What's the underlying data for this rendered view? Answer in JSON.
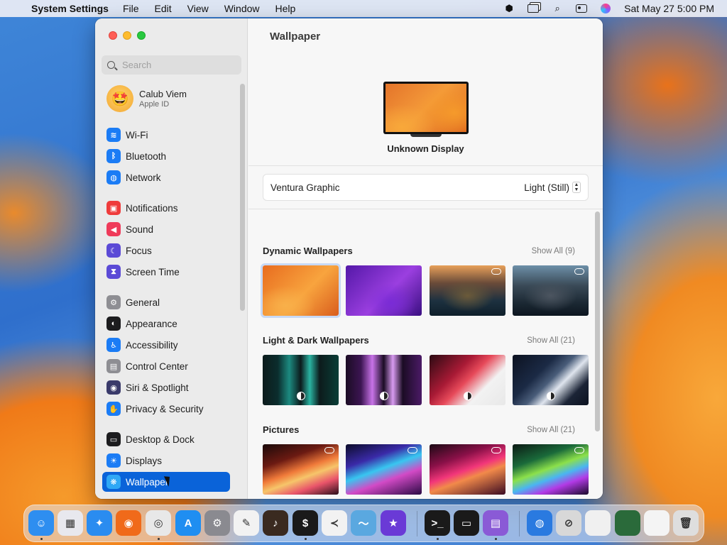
{
  "menubar": {
    "app_name": "System Settings",
    "menus": [
      "File",
      "Edit",
      "View",
      "Window",
      "Help"
    ],
    "datetime": "Sat May 27  5:00 PM"
  },
  "sidebar": {
    "search_placeholder": "Search",
    "user": {
      "name": "Calub Viem",
      "subtitle": "Apple ID"
    },
    "items": [
      {
        "label": "Wi-Fi",
        "icon": "wifi-icon",
        "color": "#1b7cf5"
      },
      {
        "label": "Bluetooth",
        "icon": "bluetooth-icon",
        "color": "#1b7cf5"
      },
      {
        "label": "Network",
        "icon": "globe-icon",
        "color": "#1b7cf5"
      },
      {
        "label": "Notifications",
        "icon": "bell-icon",
        "color": "#ef3b3b"
      },
      {
        "label": "Sound",
        "icon": "speaker-icon",
        "color": "#ef3b5a"
      },
      {
        "label": "Focus",
        "icon": "moon-icon",
        "color": "#5b4ad6"
      },
      {
        "label": "Screen Time",
        "icon": "hourglass-icon",
        "color": "#5b4ad6"
      },
      {
        "label": "General",
        "icon": "gear-icon",
        "color": "#8e8e93"
      },
      {
        "label": "Appearance",
        "icon": "appearance-icon",
        "color": "#1c1c1e"
      },
      {
        "label": "Accessibility",
        "icon": "accessibility-icon",
        "color": "#1b7cf5"
      },
      {
        "label": "Control Center",
        "icon": "control-center-icon",
        "color": "#8e8e93"
      },
      {
        "label": "Siri & Spotlight",
        "icon": "siri-icon",
        "color": "#3a3a6a"
      },
      {
        "label": "Privacy & Security",
        "icon": "hand-icon",
        "color": "#1b7cf5"
      },
      {
        "label": "Desktop & Dock",
        "icon": "desktop-icon",
        "color": "#1c1c1e"
      },
      {
        "label": "Displays",
        "icon": "sun-icon",
        "color": "#1b7cf5"
      },
      {
        "label": "Wallpaper",
        "icon": "wallpaper-icon",
        "color": "#2fa8f5",
        "selected": true
      }
    ]
  },
  "main": {
    "title": "Wallpaper",
    "display_name": "Unknown Display",
    "current_wallpaper": "Ventura Graphic",
    "mode": "Light (Still)",
    "sections": [
      {
        "title": "Dynamic Wallpapers",
        "show_all": "Show All (9)"
      },
      {
        "title": "Light & Dark Wallpapers",
        "show_all": "Show All (21)"
      },
      {
        "title": "Pictures",
        "show_all": "Show All (21)"
      }
    ]
  },
  "dock": {
    "apps": [
      {
        "name": "finder-icon",
        "color": "#2e8ef0",
        "glyph": "☺"
      },
      {
        "name": "launchpad-icon",
        "color": "#e8e8ee",
        "glyph": "▦"
      },
      {
        "name": "safari-icon",
        "color": "#2a8cf0",
        "glyph": "✦"
      },
      {
        "name": "firefox-icon",
        "color": "#f06a1a",
        "glyph": "◉"
      },
      {
        "name": "chrome-icon",
        "color": "#e8e8e8",
        "glyph": "◎"
      },
      {
        "name": "app-store-icon",
        "color": "#1f8ef1",
        "glyph": "A"
      },
      {
        "name": "system-settings-icon",
        "color": "#8a8a90",
        "glyph": "⚙"
      },
      {
        "name": "textedit-icon",
        "color": "#f2f2f2",
        "glyph": "✎"
      },
      {
        "name": "garageband-icon",
        "color": "#3a2a20",
        "glyph": "♪"
      },
      {
        "name": "terminal-green-icon",
        "color": "#1a1a1a",
        "glyph": "$"
      },
      {
        "name": "vscode-icon",
        "color": "#f2f2f2",
        "glyph": "≺"
      },
      {
        "name": "dolphin-icon",
        "color": "#5aa8e0",
        "glyph": "〜"
      },
      {
        "name": "imovie-icon",
        "color": "#6a3ad6",
        "glyph": "★"
      },
      {
        "name": "terminal-icon",
        "color": "#1a1a1a",
        "glyph": ">_"
      },
      {
        "name": "activity-monitor-icon",
        "color": "#1a1a1a",
        "glyph": "▭"
      },
      {
        "name": "storage-icon",
        "color": "#8a5ad6",
        "glyph": "▤"
      },
      {
        "name": "globe-app-icon",
        "color": "#2a7ae0",
        "glyph": "◍"
      },
      {
        "name": "disabled-app-icon",
        "color": "#d8d8d8",
        "glyph": "⊘"
      },
      {
        "name": "window-thumbnail-icon",
        "color": "#f0f0f0",
        "glyph": ""
      },
      {
        "name": "window-thumbnail-2-icon",
        "color": "#2a6a3a",
        "glyph": ""
      },
      {
        "name": "window-thumbnail-3-icon",
        "color": "#f4f4f4",
        "glyph": ""
      },
      {
        "name": "trash-icon",
        "color": "#dedede",
        "glyph": "🗑"
      }
    ]
  }
}
